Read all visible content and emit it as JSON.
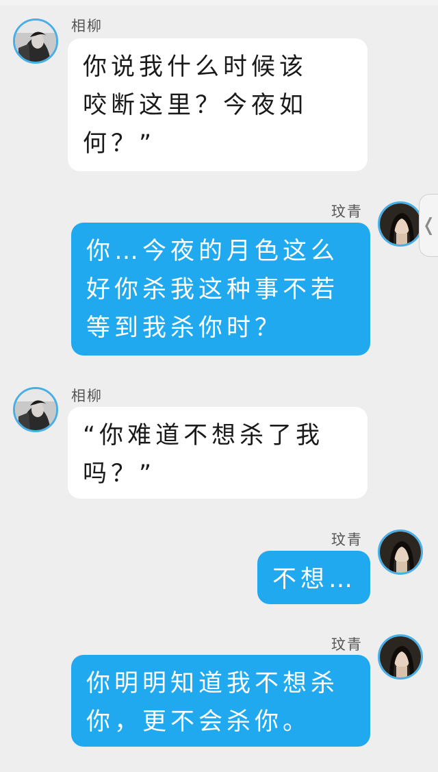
{
  "colors": {
    "background": "#eeeeee",
    "incoming_bubble": "#ffffff",
    "outgoing_bubble": "#20a9ee",
    "avatar_ring": "#48aee6"
  },
  "icons": {
    "side_handle": "chevron-left-icon"
  },
  "side_handle": {
    "glyph": "❬"
  },
  "messages": [
    {
      "sender": "相柳",
      "direction": "incoming",
      "avatar": "xiangliu-avatar",
      "text": "你说我什么时候该\n咬断这里？今夜如\n何？”"
    },
    {
      "sender": "玟青",
      "direction": "outgoing",
      "avatar": "wenqing-avatar",
      "text": "你…今夜的月色这么\n好你杀我这种事不若\n等到我杀你时？"
    },
    {
      "sender": "相柳",
      "direction": "incoming",
      "avatar": "xiangliu-avatar",
      "text": "“你难道不想杀了我\n吗？”"
    },
    {
      "sender": "玟青",
      "direction": "outgoing",
      "avatar": "wenqing-avatar",
      "text": "不想…"
    },
    {
      "sender": "玟青",
      "direction": "outgoing",
      "avatar": "wenqing-avatar",
      "text": "你明明知道我不想杀\n你，更不会杀你。"
    }
  ]
}
